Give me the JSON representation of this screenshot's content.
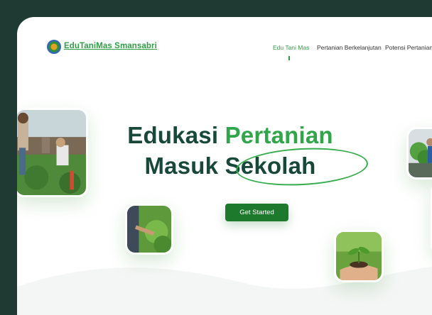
{
  "brand": {
    "name": "EduTaniMas Smansabri"
  },
  "nav": {
    "items": [
      {
        "label": "Edu Tani Mas",
        "active": true
      },
      {
        "label": "Pertanian Berkelanjutan",
        "active": false
      },
      {
        "label": "Potensi Pertanian",
        "active": false
      }
    ]
  },
  "hero": {
    "title_line1_part1": "Edukasi",
    "title_line1_part2": "Pertanian",
    "title_line2_part1": "Masuk",
    "title_line2_part2": "Sekolah",
    "cta_label": "Get Started"
  },
  "colors": {
    "frame": "#1f3a32",
    "primary_dark": "#17483a",
    "accent_green": "#30a64a",
    "button": "#1d7a2c"
  },
  "icons": [
    "logo-emblem-icon"
  ]
}
